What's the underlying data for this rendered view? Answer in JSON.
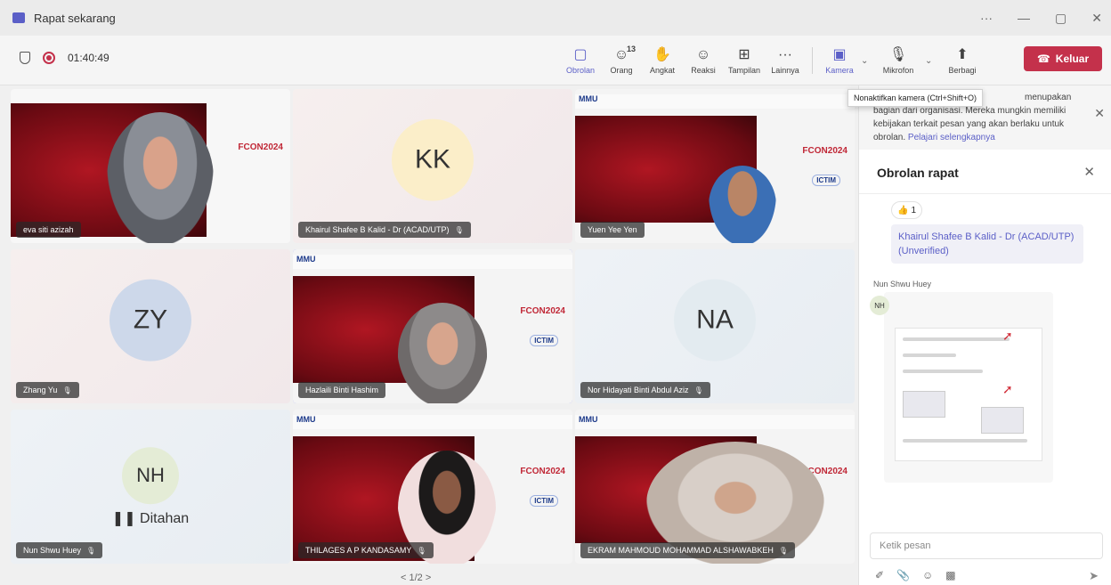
{
  "window": {
    "title": "Rapat sekarang",
    "controls": [
      "···",
      "—",
      "▢",
      "✕"
    ]
  },
  "meeting": {
    "timer": "01:40:49"
  },
  "toolbar": {
    "chat": "Obrolan",
    "people": "Orang",
    "people_count": "13",
    "raise": "Angkat",
    "react": "Reaksi",
    "view": "Tampilan",
    "more": "Lainnya",
    "camera": "Kamera",
    "mic": "Mikrofon",
    "share": "Berbagi",
    "leave": "Keluar"
  },
  "tooltip": "Nonaktifkan kamera (Ctrl+Shift+O)",
  "tiles": [
    {
      "name": "eva siti azizah"
    },
    {
      "name": "Khairul Shafee B Kalid - Dr (ACAD/UTP)",
      "initials": "KK"
    },
    {
      "name": "Yuen Yee Yen"
    },
    {
      "name": "Zhang Yu",
      "initials": "ZY"
    },
    {
      "name": "Hazlaili Binti Hashim"
    },
    {
      "name": "Nor Hidayati Binti Abdul Aziz",
      "initials": "NA"
    },
    {
      "name": "Nun Shwu Huey",
      "initials": "NH",
      "status": "Ditahan"
    },
    {
      "name": "THILAGES A P KANDASAMY"
    },
    {
      "name": "EKRAM MAHMOUD MOHAMMAD ALSHAWABKEH"
    }
  ],
  "slide": {
    "logo": "MMU",
    "conf": "FCON2024",
    "sub": "ICTIM"
  },
  "pager": "< 1/2 >",
  "chat": {
    "notice_a": "menupakan",
    "notice_b": "bagian dari organisasi. Mereka mungkin memiliki",
    "notice_c": "kebijakan terkait pesan yang akan berlaku untuk",
    "notice_d": "obrolan.",
    "notice_link": "Pelajari selengkapnya",
    "title": "Obrolan rapat",
    "reaction_count": "1",
    "message_link": "Khairul Shafee B Kalid - Dr (ACAD/UTP) (Unverified)",
    "sender": "Nun Shwu Huey",
    "sender_initials": "NH",
    "compose_placeholder": "Ketik pesan"
  }
}
